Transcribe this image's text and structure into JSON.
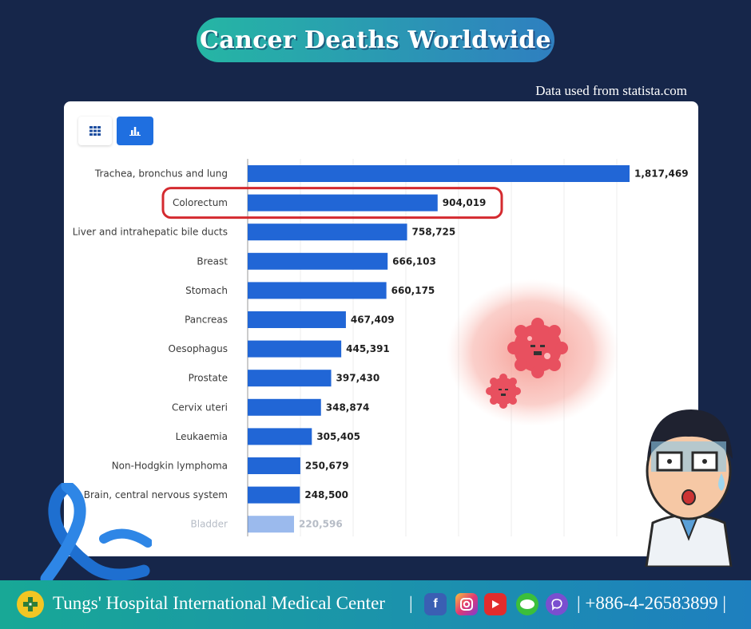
{
  "header": {
    "title": "Cancer Deaths Worldwide",
    "source": "Data used from statista.com"
  },
  "toolbar": {
    "table_icon": "grid-icon",
    "chart_icon": "bar-chart-icon"
  },
  "chart_data": {
    "type": "bar",
    "orientation": "horizontal",
    "categories": [
      "Trachea, bronchus and lung",
      "Colorectum",
      "Liver and intrahepatic bile ducts",
      "Breast",
      "Stomach",
      "Pancreas",
      "Oesophagus",
      "Prostate",
      "Cervix uteri",
      "Leukaemia",
      "Non-Hodgkin lymphoma",
      "Brain, central nervous system",
      "Bladder"
    ],
    "values": [
      1817469,
      904019,
      758725,
      666103,
      660175,
      467409,
      445391,
      397430,
      348874,
      305405,
      250679,
      248500,
      220596
    ],
    "value_labels": [
      "1,817,469",
      "904,019",
      "758,725",
      "666,103",
      "660,175",
      "467,409",
      "445,391",
      "397,430",
      "348,874",
      "305,405",
      "250,679",
      "248,500",
      "220,596"
    ],
    "highlighted": "Colorectum",
    "bar_color": "#2166d6",
    "highlight_color": "#d42a2f",
    "grid": true
  },
  "footer": {
    "org": "Tungs' Hospital International Medical Center",
    "sep": "|",
    "phone": "| +886-4-26583899 |",
    "social": [
      "facebook-icon",
      "instagram-icon",
      "youtube-icon",
      "line-icon",
      "viber-icon"
    ]
  }
}
